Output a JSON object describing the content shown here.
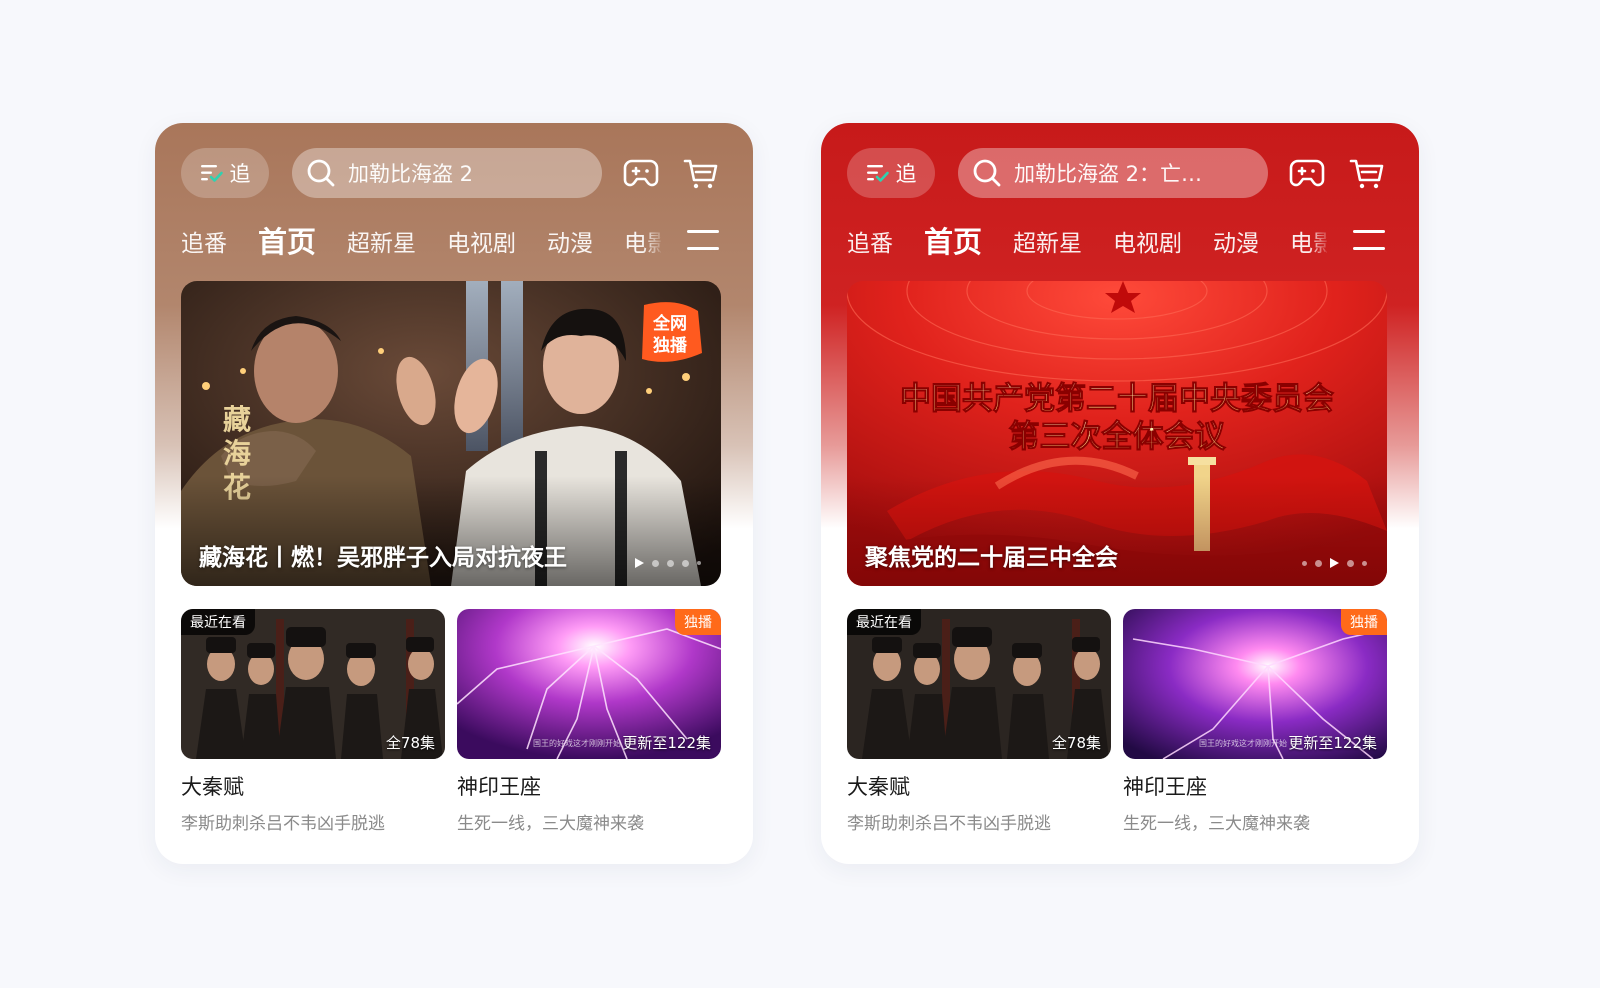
{
  "phones": [
    {
      "id": "left",
      "follow_label": "追",
      "search_text": "加勒比海盗 2",
      "tabs": [
        "追番",
        "首页",
        "超新星",
        "电视剧",
        "动漫",
        "电影"
      ],
      "active_tab": "首页",
      "banner": {
        "caption": "藏海花丨燃！吴邪胖子入局对抗夜王",
        "badge": "全网独播",
        "poster_title": "藏海花",
        "dots": 5,
        "active_dot": 0
      },
      "cards": [
        {
          "badge": "最近在看",
          "badge_pos": "tl",
          "episodes": "全78集",
          "title": "大秦赋",
          "subtitle": "李斯助刺杀吕不韦凶手脱逃"
        },
        {
          "badge": "独播",
          "badge_pos": "tr",
          "episodes": "更新至122集",
          "small_caption": "国王的好戏这才刚刚开始",
          "title": "神印王座",
          "subtitle": "生死一线，三大魔神来袭"
        }
      ]
    },
    {
      "id": "right",
      "follow_label": "追",
      "search_text": "加勒比海盗 2：亡…",
      "tabs": [
        "追番",
        "首页",
        "超新星",
        "电视剧",
        "动漫",
        "电影"
      ],
      "active_tab": "首页",
      "banner": {
        "caption": "聚焦党的二十届三中全会",
        "headline_1": "中国共产党第二十届中央委员会",
        "headline_2": "第三次全体会议",
        "dots": 5,
        "active_dot": 2
      },
      "cards": [
        {
          "badge": "最近在看",
          "badge_pos": "tl",
          "episodes": "全78集",
          "title": "大秦赋",
          "subtitle": "李斯助刺杀吕不韦凶手脱逃"
        },
        {
          "badge": "独播",
          "badge_pos": "tr",
          "episodes": "更新至122集",
          "small_caption": "国王的好戏这才刚刚开始",
          "title": "神印王座",
          "subtitle": "生死一线，三大魔神来袭"
        }
      ]
    }
  ],
  "icons": [
    "follow-list-icon",
    "search-icon",
    "game-controller-icon",
    "shopping-cart-icon",
    "menu-icon"
  ],
  "colors": {
    "left_header": "#a9765a",
    "right_header": "#c71a1a",
    "exclusive_badge": "#ff6a1a",
    "title_text": "#1a1a1a",
    "subtitle_text": "#8a8a8a"
  }
}
